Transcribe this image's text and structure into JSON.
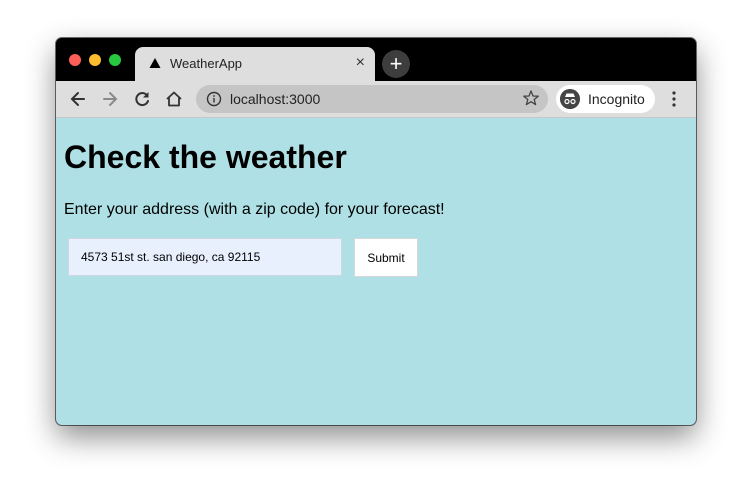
{
  "browser": {
    "tab": {
      "title": "WeatherApp",
      "close_glyph": "×"
    },
    "new_tab_glyph": "+",
    "address_bar": {
      "url": "localhost:3000"
    },
    "profile": {
      "label": "Incognito"
    }
  },
  "page": {
    "heading": "Check the weather",
    "subtitle": "Enter your address (with a zip code) for your forecast!",
    "address_input": {
      "value": "4573 51st st. san diego, ca 92115"
    },
    "submit_label": "Submit"
  }
}
